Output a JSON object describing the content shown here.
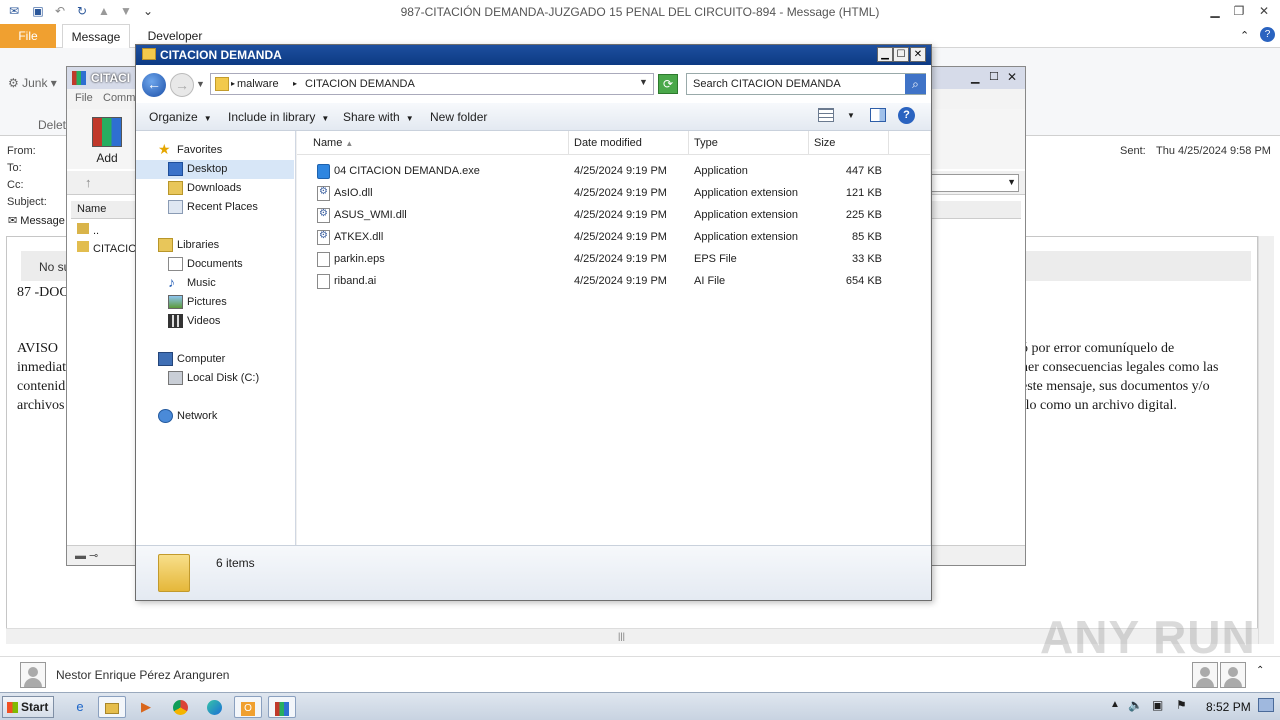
{
  "outlook": {
    "title": "987-CITACIÓN  DEMANDA-JUZGADO 15 PENAL DEL CIRCUITO-894  -  Message (HTML)",
    "tabs": {
      "file": "File",
      "message": "Message",
      "developer": "Developer"
    },
    "ribbon": {
      "junk": "Junk",
      "delete_group": "Delete"
    },
    "headers": {
      "from_label": "From:",
      "to_label": "To:",
      "cc_label": "Cc:",
      "subject_label": "Subject:",
      "sent_label": "Sent:",
      "sent_value": "Thu 4/25/2024 9:58 PM",
      "message_tab": "Message"
    },
    "body": {
      "notice": "No su",
      "line1": "87 -DOC",
      "left_lines": [
        "AVISO",
        "inmediat",
        "contenid",
        "archivos"
      ],
      "right_lines": [
        "ó por error comuníquelo de",
        "ner consecuencias legales como las",
        "este mensaje, sus documentos y/o",
        "rlo como un archivo digital."
      ]
    },
    "sender": "Nestor Enrique Pérez Aranguren"
  },
  "winrar": {
    "title": "CITACI",
    "menu": [
      "File",
      "Comm"
    ],
    "add_label": "Add",
    "list_header": "Name",
    "rows": [
      "..",
      "CITACIO"
    ]
  },
  "explorer": {
    "title": "CITACION DEMANDA",
    "address": {
      "crumb1": "malware",
      "crumb2": "CITACION DEMANDA"
    },
    "search_placeholder": "Search CITACION DEMANDA",
    "commands": {
      "organize": "Organize",
      "include": "Include in library",
      "share": "Share with",
      "new_folder": "New folder"
    },
    "nav": {
      "favorites": "Favorites",
      "desktop": "Desktop",
      "downloads": "Downloads",
      "recent": "Recent Places",
      "libraries": "Libraries",
      "documents": "Documents",
      "music": "Music",
      "pictures": "Pictures",
      "videos": "Videos",
      "computer": "Computer",
      "local_disk": "Local Disk (C:)",
      "network": "Network"
    },
    "columns": {
      "name": "Name",
      "date": "Date modified",
      "type": "Type",
      "size": "Size"
    },
    "files": [
      {
        "name": "04 CITACION DEMANDA.exe",
        "date": "4/25/2024 9:19 PM",
        "type": "Application",
        "size": "447 KB",
        "icon": "app-icon"
      },
      {
        "name": "AsIO.dll",
        "date": "4/25/2024 9:19 PM",
        "type": "Application extension",
        "size": "121 KB",
        "icon": "dll-icon"
      },
      {
        "name": "ASUS_WMI.dll",
        "date": "4/25/2024 9:19 PM",
        "type": "Application extension",
        "size": "225 KB",
        "icon": "dll-icon"
      },
      {
        "name": "ATKEX.dll",
        "date": "4/25/2024 9:19 PM",
        "type": "Application extension",
        "size": "85 KB",
        "icon": "dll-icon"
      },
      {
        "name": "parkin.eps",
        "date": "4/25/2024 9:19 PM",
        "type": "EPS File",
        "size": "33 KB",
        "icon": "file-icon"
      },
      {
        "name": "riband.ai",
        "date": "4/25/2024 9:19 PM",
        "type": "AI File",
        "size": "654 KB",
        "icon": "file-icon"
      }
    ],
    "status": "6 items"
  },
  "taskbar": {
    "start": "Start",
    "clock": "8:52 PM"
  },
  "watermark": "ANY RUN"
}
